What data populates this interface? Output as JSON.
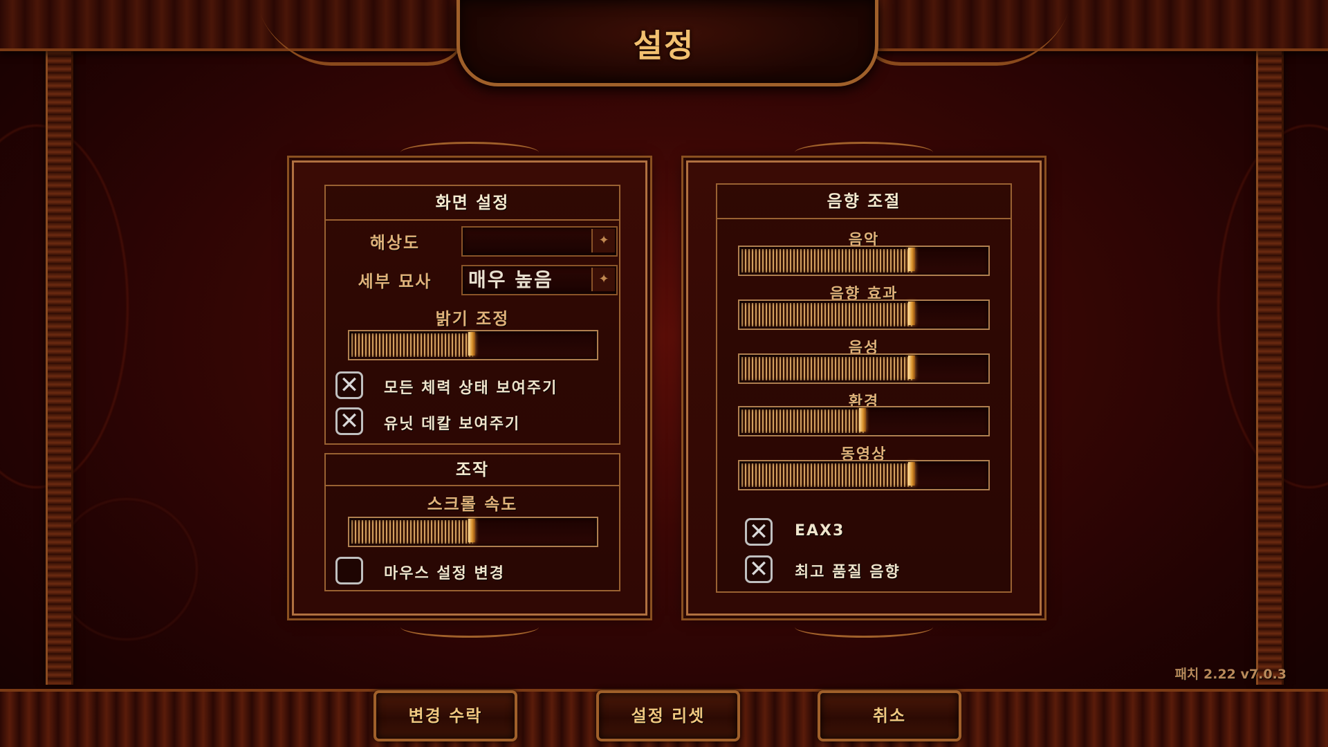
{
  "header": {
    "title": "설정"
  },
  "display": {
    "section_title": "화면 설정",
    "resolution_label": "해상도",
    "resolution_value": "",
    "detail_label": "세부 묘사",
    "detail_value": "매우 높음",
    "brightness_label": "밝기 조정",
    "brightness_level": 0.5,
    "options": [
      {
        "label": "모든 체력 상태 보여주기",
        "checked": true
      },
      {
        "label": "유닛 데칼 보여주기",
        "checked": true
      }
    ]
  },
  "controls": {
    "section_title": "조작",
    "scroll_label": "스크롤 속도",
    "scroll_level": 0.5,
    "mouse_label": "마우스 설정 변경",
    "mouse_checked": false
  },
  "audio": {
    "section_title": "음향 조절",
    "sliders": [
      {
        "label": "음악",
        "level": 0.7
      },
      {
        "label": "음향 효과",
        "level": 0.7
      },
      {
        "label": "음성",
        "level": 0.7
      },
      {
        "label": "환경",
        "level": 0.5
      },
      {
        "label": "동영상",
        "level": 0.7
      }
    ],
    "options": [
      {
        "label": "EAX3",
        "checked": true
      },
      {
        "label": "최고 품질 음향",
        "checked": true
      }
    ]
  },
  "footer": {
    "accept_label": "변경 수락",
    "reset_label": "설정 리셋",
    "cancel_label": "취소",
    "version": "패치 2.22 v7.0.3"
  },
  "icons": {
    "checked": "close-x-icon",
    "dropdown": "dropdown-arrow-icon"
  },
  "colors": {
    "accent_gold": "#f2c070",
    "frame_bronze": "#b07040",
    "background_red": "#3a0705"
  }
}
